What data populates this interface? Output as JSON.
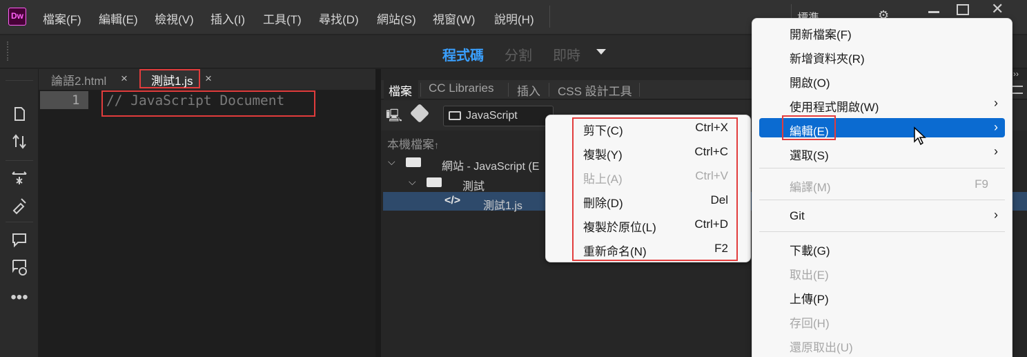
{
  "app": {
    "logo": "Dw"
  },
  "menubar": {
    "items": [
      "檔案(F)",
      "編輯(E)",
      "檢視(V)",
      "插入(I)",
      "工具(T)",
      "尋找(D)",
      "網站(S)",
      "視窗(W)",
      "說明(H)"
    ],
    "workspace": "標準"
  },
  "views": {
    "code": "程式碼",
    "split": "分割",
    "live": "即時"
  },
  "doc_tabs": [
    {
      "label": "論語2.html",
      "close": "×"
    },
    {
      "label": "測試1.js",
      "close": "×"
    }
  ],
  "editor": {
    "line_number": "1",
    "code": "// JavaScript Document"
  },
  "panel": {
    "tabs": [
      "檔案",
      "CC Libraries",
      "插入",
      "CSS 設計工具"
    ],
    "site_select": "JavaScript",
    "local_label": "本機檔案",
    "sort_arrow": "↑",
    "tree": [
      {
        "label": "網站 - JavaScript (E"
      },
      {
        "label": "測試"
      },
      {
        "label": "測試1.js"
      }
    ]
  },
  "submenu": [
    {
      "label": "剪下(C)",
      "shortcut": "Ctrl+X",
      "disabled": false
    },
    {
      "label": "複製(Y)",
      "shortcut": "Ctrl+C",
      "disabled": false
    },
    {
      "label": "貼上(A)",
      "shortcut": "Ctrl+V",
      "disabled": true
    },
    {
      "label": "刪除(D)",
      "shortcut": "Del",
      "disabled": false
    },
    {
      "label": "複製於原位(L)",
      "shortcut": "Ctrl+D",
      "disabled": false
    },
    {
      "label": "重新命名(N)",
      "shortcut": "F2",
      "disabled": false
    }
  ],
  "context_menu": {
    "items": [
      {
        "label": "開新檔案(F)"
      },
      {
        "label": "新增資料夾(R)"
      },
      {
        "label": "開啟(O)"
      },
      {
        "label": "使用程式開啟(W)",
        "submenu": true
      },
      {
        "label": "編輯(E)",
        "submenu": true,
        "highlighted": true
      },
      {
        "label": "選取(S)",
        "submenu": true
      },
      {
        "label": "編譯(M)",
        "shortcut": "F9",
        "disabled": true
      },
      {
        "label": "Git",
        "submenu": true
      },
      {
        "label": "下載(G)"
      },
      {
        "label": "取出(E)",
        "disabled": true
      },
      {
        "label": "上傳(P)"
      },
      {
        "label": "存回(H)",
        "disabled": true
      },
      {
        "label": "還原取出(U)",
        "disabled": true
      }
    ],
    "arrow": "›"
  },
  "colors": {
    "accent": "#3aa0ff",
    "highlight": "#0b6bd1",
    "annotation": "#e23c3c",
    "logo_bg": "#470137",
    "logo_fg": "#ff61f6"
  }
}
